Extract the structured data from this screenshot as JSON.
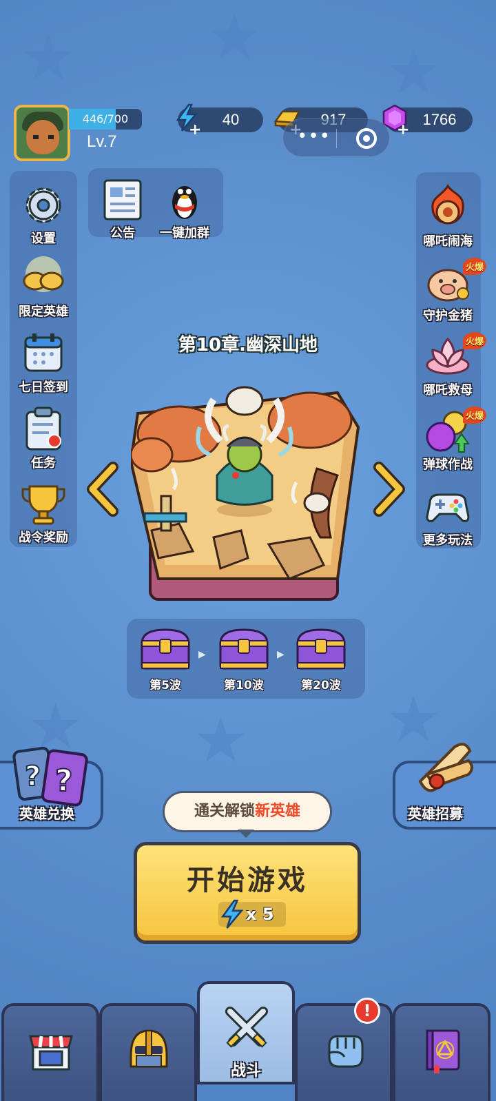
{
  "player": {
    "xp_text": "446/700",
    "xp_progress": 0.637,
    "level": "Lv.7"
  },
  "resources": {
    "energy": "40",
    "gold": "917",
    "gems": "1766"
  },
  "left_menu": [
    {
      "label": "设置",
      "icon": "gear-icon"
    },
    {
      "label": "限定英雄",
      "icon": "cloud-hero-icon"
    },
    {
      "label": "七日签到",
      "icon": "calendar-icon"
    },
    {
      "label": "任务",
      "icon": "clipboard-icon"
    },
    {
      "label": "战令奖励",
      "icon": "trophy-icon"
    }
  ],
  "top_panel": [
    {
      "label": "公告",
      "icon": "newspaper-icon"
    },
    {
      "label": "一键加群",
      "icon": "qq-penguin-icon"
    }
  ],
  "right_menu": [
    {
      "label": "哪吒闹海",
      "icon": "fire-wheel-icon",
      "badge": ""
    },
    {
      "label": "守护金猪",
      "icon": "golden-pig-icon",
      "badge": "火爆"
    },
    {
      "label": "哪吒救母",
      "icon": "lotus-icon",
      "badge": "火爆"
    },
    {
      "label": "弹球作战",
      "icon": "pinball-icon",
      "badge": "火爆"
    },
    {
      "label": "更多玩法",
      "icon": "gamepad-icon",
      "badge": ""
    }
  ],
  "chapter": {
    "title": "第10章.幽深山地"
  },
  "wave_rewards": [
    {
      "label": "第5波"
    },
    {
      "label": "第10波"
    },
    {
      "label": "第20波"
    }
  ],
  "hero_exchange_label": "英雄兑换",
  "hero_recruit_label": "英雄招募",
  "unlock": {
    "prefix": "通关解锁",
    "highlight": "新英雄"
  },
  "start": {
    "label": "开始游戏",
    "cost": "x 5"
  },
  "nav": {
    "tabs": [
      {
        "icon": "shop-icon",
        "label": ""
      },
      {
        "icon": "helmet-icon",
        "label": ""
      },
      {
        "icon": "crossed-swords-icon",
        "label": "战斗"
      },
      {
        "icon": "fist-icon",
        "label": "",
        "alert": "!"
      },
      {
        "icon": "spellbook-icon",
        "label": ""
      }
    ]
  },
  "colors": {
    "background": "#5b8fcf",
    "start_button": "#f5c53d",
    "highlight_text": "#f04a2a",
    "alert": "#e83b2f"
  }
}
